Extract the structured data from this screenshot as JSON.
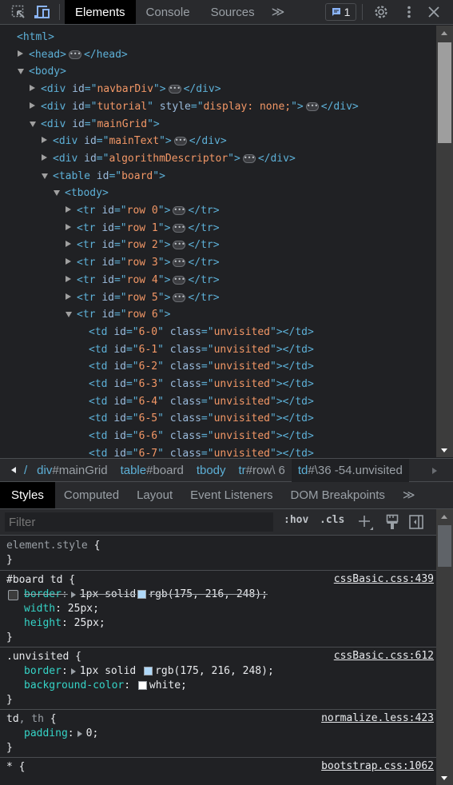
{
  "toolbar": {
    "tabs": [
      {
        "label": "Elements",
        "active": true
      },
      {
        "label": "Console",
        "active": false
      },
      {
        "label": "Sources",
        "active": false
      }
    ],
    "more_tabs": "≫",
    "issues_count": "1",
    "icons": [
      "inspect-element-icon",
      "device-toolbar-icon",
      "issues-icon",
      "settings-gear-icon",
      "more-vertical-icon",
      "close-icon"
    ]
  },
  "tree": {
    "lines": [
      {
        "indent": 0,
        "toggle": "none",
        "parts": [
          [
            "tag",
            "<html>"
          ]
        ]
      },
      {
        "indent": 1,
        "toggle": "right",
        "parts": [
          [
            "tag",
            "<head>"
          ],
          [
            "ell",
            ""
          ],
          [
            "tag",
            "</head>"
          ]
        ]
      },
      {
        "indent": 1,
        "toggle": "down",
        "parts": [
          [
            "tag",
            "<body>"
          ]
        ]
      },
      {
        "indent": 2,
        "toggle": "right",
        "parts": [
          [
            "tag",
            "<div "
          ],
          [
            "attr",
            "id"
          ],
          [
            "tag",
            "=\""
          ],
          [
            "val",
            "navbarDiv"
          ],
          [
            "tag",
            "\">"
          ],
          [
            "ell",
            ""
          ],
          [
            "tag",
            "</div>"
          ]
        ]
      },
      {
        "indent": 2,
        "toggle": "right",
        "parts": [
          [
            "tag",
            "<div "
          ],
          [
            "attr",
            "id"
          ],
          [
            "tag",
            "=\""
          ],
          [
            "val",
            "tutorial"
          ],
          [
            "tag",
            "\" "
          ],
          [
            "attr",
            "style"
          ],
          [
            "tag",
            "=\""
          ],
          [
            "val",
            "display: none;"
          ],
          [
            "tag",
            "\">"
          ],
          [
            "ell",
            ""
          ],
          [
            "tag",
            "</div>"
          ]
        ]
      },
      {
        "indent": 2,
        "toggle": "down",
        "parts": [
          [
            "tag",
            "<div "
          ],
          [
            "attr",
            "id"
          ],
          [
            "tag",
            "=\""
          ],
          [
            "val",
            "mainGrid"
          ],
          [
            "tag",
            "\">"
          ]
        ]
      },
      {
        "indent": 3,
        "toggle": "right",
        "parts": [
          [
            "tag",
            "<div "
          ],
          [
            "attr",
            "id"
          ],
          [
            "tag",
            "=\""
          ],
          [
            "val",
            "mainText"
          ],
          [
            "tag",
            "\">"
          ],
          [
            "ell",
            ""
          ],
          [
            "tag",
            "</div>"
          ]
        ]
      },
      {
        "indent": 3,
        "toggle": "right",
        "parts": [
          [
            "tag",
            "<div "
          ],
          [
            "attr",
            "id"
          ],
          [
            "tag",
            "=\""
          ],
          [
            "val",
            "algorithmDescriptor"
          ],
          [
            "tag",
            "\">"
          ],
          [
            "ell",
            ""
          ],
          [
            "tag",
            "</div>"
          ]
        ]
      },
      {
        "indent": 3,
        "toggle": "down",
        "parts": [
          [
            "tag",
            "<table "
          ],
          [
            "attr",
            "id"
          ],
          [
            "tag",
            "=\""
          ],
          [
            "val",
            "board"
          ],
          [
            "tag",
            "\">"
          ]
        ]
      },
      {
        "indent": 4,
        "toggle": "down",
        "parts": [
          [
            "tag",
            "<tbody>"
          ]
        ]
      },
      {
        "indent": 5,
        "toggle": "right",
        "parts": [
          [
            "tag",
            "<tr "
          ],
          [
            "attr",
            "id"
          ],
          [
            "tag",
            "=\""
          ],
          [
            "val",
            "row 0"
          ],
          [
            "tag",
            "\">"
          ],
          [
            "ell",
            ""
          ],
          [
            "tag",
            "</tr>"
          ]
        ]
      },
      {
        "indent": 5,
        "toggle": "right",
        "parts": [
          [
            "tag",
            "<tr "
          ],
          [
            "attr",
            "id"
          ],
          [
            "tag",
            "=\""
          ],
          [
            "val",
            "row 1"
          ],
          [
            "tag",
            "\">"
          ],
          [
            "ell",
            ""
          ],
          [
            "tag",
            "</tr>"
          ]
        ]
      },
      {
        "indent": 5,
        "toggle": "right",
        "parts": [
          [
            "tag",
            "<tr "
          ],
          [
            "attr",
            "id"
          ],
          [
            "tag",
            "=\""
          ],
          [
            "val",
            "row 2"
          ],
          [
            "tag",
            "\">"
          ],
          [
            "ell",
            ""
          ],
          [
            "tag",
            "</tr>"
          ]
        ]
      },
      {
        "indent": 5,
        "toggle": "right",
        "parts": [
          [
            "tag",
            "<tr "
          ],
          [
            "attr",
            "id"
          ],
          [
            "tag",
            "=\""
          ],
          [
            "val",
            "row 3"
          ],
          [
            "tag",
            "\">"
          ],
          [
            "ell",
            ""
          ],
          [
            "tag",
            "</tr>"
          ]
        ]
      },
      {
        "indent": 5,
        "toggle": "right",
        "parts": [
          [
            "tag",
            "<tr "
          ],
          [
            "attr",
            "id"
          ],
          [
            "tag",
            "=\""
          ],
          [
            "val",
            "row 4"
          ],
          [
            "tag",
            "\">"
          ],
          [
            "ell",
            ""
          ],
          [
            "tag",
            "</tr>"
          ]
        ]
      },
      {
        "indent": 5,
        "toggle": "right",
        "parts": [
          [
            "tag",
            "<tr "
          ],
          [
            "attr",
            "id"
          ],
          [
            "tag",
            "=\""
          ],
          [
            "val",
            "row 5"
          ],
          [
            "tag",
            "\">"
          ],
          [
            "ell",
            ""
          ],
          [
            "tag",
            "</tr>"
          ]
        ]
      },
      {
        "indent": 5,
        "toggle": "down",
        "parts": [
          [
            "tag",
            "<tr "
          ],
          [
            "attr",
            "id"
          ],
          [
            "tag",
            "=\""
          ],
          [
            "val",
            "row 6"
          ],
          [
            "tag",
            "\">"
          ]
        ]
      },
      {
        "indent": 6,
        "toggle": "none",
        "parts": [
          [
            "tag",
            "<td "
          ],
          [
            "attr",
            "id"
          ],
          [
            "tag",
            "=\""
          ],
          [
            "val",
            "6-0"
          ],
          [
            "tag",
            "\" "
          ],
          [
            "attr",
            "class"
          ],
          [
            "tag",
            "=\""
          ],
          [
            "val",
            "unvisited"
          ],
          [
            "tag",
            "\"></td>"
          ]
        ]
      },
      {
        "indent": 6,
        "toggle": "none",
        "parts": [
          [
            "tag",
            "<td "
          ],
          [
            "attr",
            "id"
          ],
          [
            "tag",
            "=\""
          ],
          [
            "val",
            "6-1"
          ],
          [
            "tag",
            "\" "
          ],
          [
            "attr",
            "class"
          ],
          [
            "tag",
            "=\""
          ],
          [
            "val",
            "unvisited"
          ],
          [
            "tag",
            "\"></td>"
          ]
        ]
      },
      {
        "indent": 6,
        "toggle": "none",
        "parts": [
          [
            "tag",
            "<td "
          ],
          [
            "attr",
            "id"
          ],
          [
            "tag",
            "=\""
          ],
          [
            "val",
            "6-2"
          ],
          [
            "tag",
            "\" "
          ],
          [
            "attr",
            "class"
          ],
          [
            "tag",
            "=\""
          ],
          [
            "val",
            "unvisited"
          ],
          [
            "tag",
            "\"></td>"
          ]
        ]
      },
      {
        "indent": 6,
        "toggle": "none",
        "parts": [
          [
            "tag",
            "<td "
          ],
          [
            "attr",
            "id"
          ],
          [
            "tag",
            "=\""
          ],
          [
            "val",
            "6-3"
          ],
          [
            "tag",
            "\" "
          ],
          [
            "attr",
            "class"
          ],
          [
            "tag",
            "=\""
          ],
          [
            "val",
            "unvisited"
          ],
          [
            "tag",
            "\"></td>"
          ]
        ]
      },
      {
        "indent": 6,
        "toggle": "none",
        "parts": [
          [
            "tag",
            "<td "
          ],
          [
            "attr",
            "id"
          ],
          [
            "tag",
            "=\""
          ],
          [
            "val",
            "6-4"
          ],
          [
            "tag",
            "\" "
          ],
          [
            "attr",
            "class"
          ],
          [
            "tag",
            "=\""
          ],
          [
            "val",
            "unvisited"
          ],
          [
            "tag",
            "\"></td>"
          ]
        ]
      },
      {
        "indent": 6,
        "toggle": "none",
        "parts": [
          [
            "tag",
            "<td "
          ],
          [
            "attr",
            "id"
          ],
          [
            "tag",
            "=\""
          ],
          [
            "val",
            "6-5"
          ],
          [
            "tag",
            "\" "
          ],
          [
            "attr",
            "class"
          ],
          [
            "tag",
            "=\""
          ],
          [
            "val",
            "unvisited"
          ],
          [
            "tag",
            "\"></td>"
          ]
        ]
      },
      {
        "indent": 6,
        "toggle": "none",
        "parts": [
          [
            "tag",
            "<td "
          ],
          [
            "attr",
            "id"
          ],
          [
            "tag",
            "=\""
          ],
          [
            "val",
            "6-6"
          ],
          [
            "tag",
            "\" "
          ],
          [
            "attr",
            "class"
          ],
          [
            "tag",
            "=\""
          ],
          [
            "val",
            "unvisited"
          ],
          [
            "tag",
            "\"></td>"
          ]
        ]
      },
      {
        "indent": 6,
        "toggle": "none",
        "parts": [
          [
            "tag",
            "<td "
          ],
          [
            "attr",
            "id"
          ],
          [
            "tag",
            "=\""
          ],
          [
            "val",
            "6-7"
          ],
          [
            "tag",
            "\" "
          ],
          [
            "attr",
            "class"
          ],
          [
            "tag",
            "=\""
          ],
          [
            "val",
            "unvisited"
          ],
          [
            "tag",
            "\"></td>"
          ]
        ]
      }
    ]
  },
  "breadcrumbs": [
    {
      "tag": "",
      "rest": "/"
    },
    {
      "tag": "div",
      "rest": "#mainGrid"
    },
    {
      "tag": "table",
      "rest": "#board"
    },
    {
      "tag": "tbody",
      "rest": ""
    },
    {
      "tag": "tr",
      "rest": "#row\\ 6"
    },
    {
      "tag": "td",
      "rest": "#\\36 -54.unvisited",
      "selected": true
    }
  ],
  "styles_tabs": [
    {
      "label": "Styles",
      "active": true
    },
    {
      "label": "Computed"
    },
    {
      "label": "Layout"
    },
    {
      "label": "Event Listeners"
    },
    {
      "label": "DOM Breakpoints"
    }
  ],
  "styles_more": "≫",
  "filter": {
    "placeholder": "Filter",
    "value": ""
  },
  "filter_buttons": {
    "hov": ":hov",
    "cls": ".cls"
  },
  "rules": {
    "element_style": {
      "selector": "element.style"
    },
    "board_td": {
      "selector": "#board td",
      "source": "cssBasic.css:439",
      "props": [
        {
          "name": "border",
          "value_pre": "1px solid",
          "swatch": "#afd8f8",
          "value": "rgb(175, 216, 248);",
          "disabled": true
        },
        {
          "name": "width",
          "value": "25px;"
        },
        {
          "name": "height",
          "value": "25px;"
        }
      ]
    },
    "unvisited": {
      "selector": ".unvisited",
      "source": "cssBasic.css:612",
      "props": [
        {
          "name": "border",
          "value_pre": "1px solid",
          "swatch": "#afd8f8",
          "value": "rgb(175, 216, 248);"
        },
        {
          "name": "background-color",
          "swatch": "#ffffff",
          "value": "white;"
        }
      ]
    },
    "td_th": {
      "selector_main": "td",
      "selector_dim": ", th",
      "source": "normalize.less:423",
      "props": [
        {
          "name": "padding",
          "value": "0;"
        }
      ]
    },
    "star": {
      "selector": "* {",
      "source": "bootstrap.css:1062"
    }
  }
}
